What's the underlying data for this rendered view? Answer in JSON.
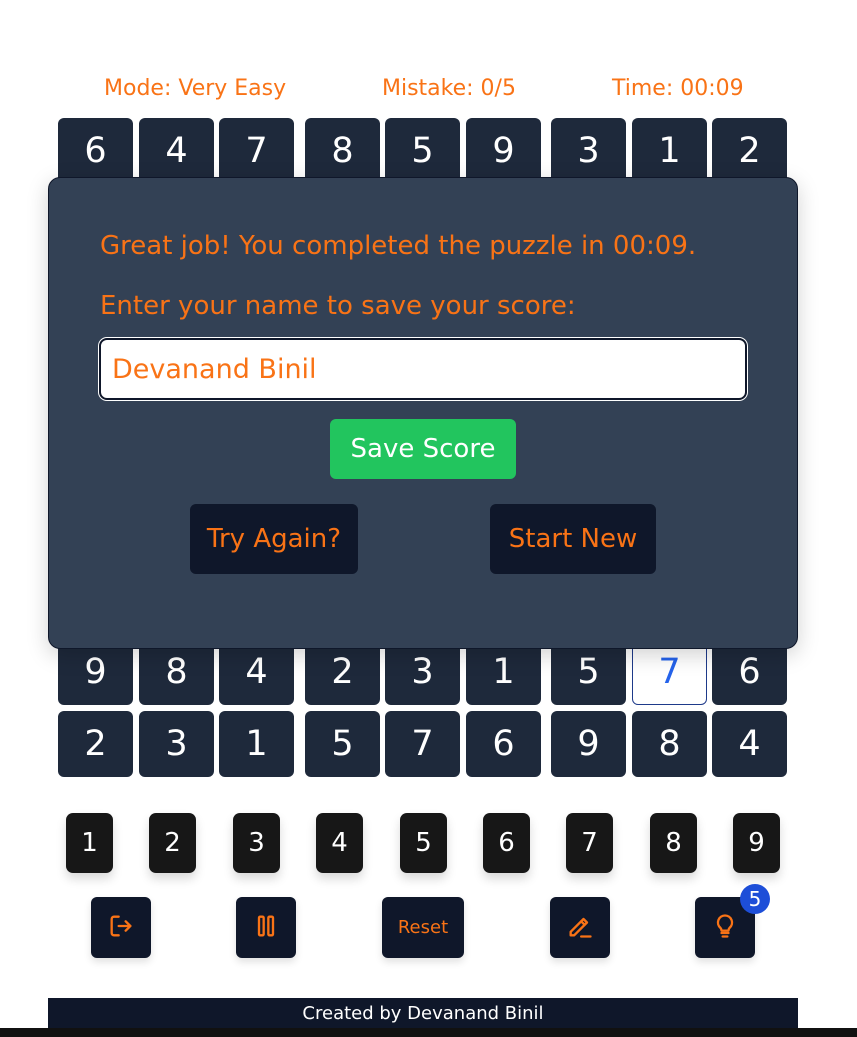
{
  "status": {
    "mode": "Mode: Very Easy",
    "mistakes": "Mistake: 0/5",
    "time": "Time: 00:09"
  },
  "board": {
    "row_top": [
      "6",
      "4",
      "7",
      "8",
      "5",
      "9",
      "3",
      "1",
      "2"
    ],
    "row_8": [
      "9",
      "8",
      "4",
      "2",
      "3",
      "1",
      "5",
      "7",
      "6"
    ],
    "row_9": [
      "2",
      "3",
      "1",
      "5",
      "7",
      "6",
      "9",
      "8",
      "4"
    ],
    "selected_value": "7"
  },
  "modal": {
    "congrats": "Great job! You completed the puzzle in 00:09.",
    "prompt": "Enter your name to save your score:",
    "name_value": "Devanand Binil",
    "save_label": "Save Score",
    "try_again_label": "Try Again?",
    "start_new_label": "Start New"
  },
  "numpad": [
    "1",
    "2",
    "3",
    "4",
    "5",
    "6",
    "7",
    "8",
    "9"
  ],
  "toolbar": {
    "exit_icon": "exit-icon",
    "pause_icon": "pause-icon",
    "reset_label": "Reset",
    "notes_icon": "pencil-icon",
    "hint_icon": "lightbulb-icon",
    "hint_count": "5"
  },
  "footer": {
    "credit": "Created by Devanand Binil"
  },
  "colors": {
    "accent": "#f97316",
    "cell": "#1e293b",
    "modal": "#334155",
    "dark_button": "#0f172a",
    "save_button": "#22c55e",
    "badge": "#1d4ed8",
    "selected_digit": "#2563eb"
  }
}
